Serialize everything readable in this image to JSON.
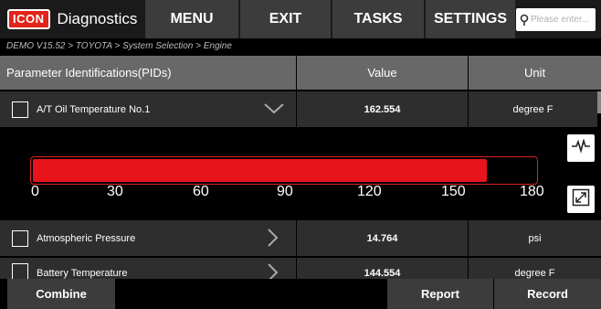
{
  "header": {
    "logo_text": "ICON",
    "app_title": "Diagnostics",
    "nav": {
      "menu": "MENU",
      "exit": "EXIT",
      "tasks": "TASKS",
      "settings": "SETTINGS"
    },
    "search": {
      "placeholder": "Please enter...",
      "value": ""
    }
  },
  "breadcrumb": "DEMO V15.52 > TOYOTA > System Selection > Engine",
  "table": {
    "headers": {
      "param": "Parameter Identifications(PIDs)",
      "value": "Value",
      "unit": "Unit"
    },
    "rows": [
      {
        "name": "A/T Oil Temperature No.1",
        "value": "162.554",
        "unit": "degree F",
        "expanded": true
      },
      {
        "name": "Atmospheric Pressure",
        "value": "14.764",
        "unit": "psi",
        "expanded": false
      },
      {
        "name": "Battery Temperature",
        "value": "144.554",
        "unit": "degree F",
        "expanded": false
      }
    ]
  },
  "gauge": {
    "min": 0,
    "max": 180,
    "value": 162.554,
    "ticks": [
      "0",
      "30",
      "60",
      "90",
      "120",
      "150",
      "180"
    ],
    "color": "#e8141c"
  },
  "footer": {
    "combine": "Combine",
    "report": "Report",
    "record": "Record"
  },
  "colors": {
    "accent": "#e2231a",
    "button": "#3c3c3c",
    "header": "#686868",
    "row": "#2e2e2e"
  }
}
